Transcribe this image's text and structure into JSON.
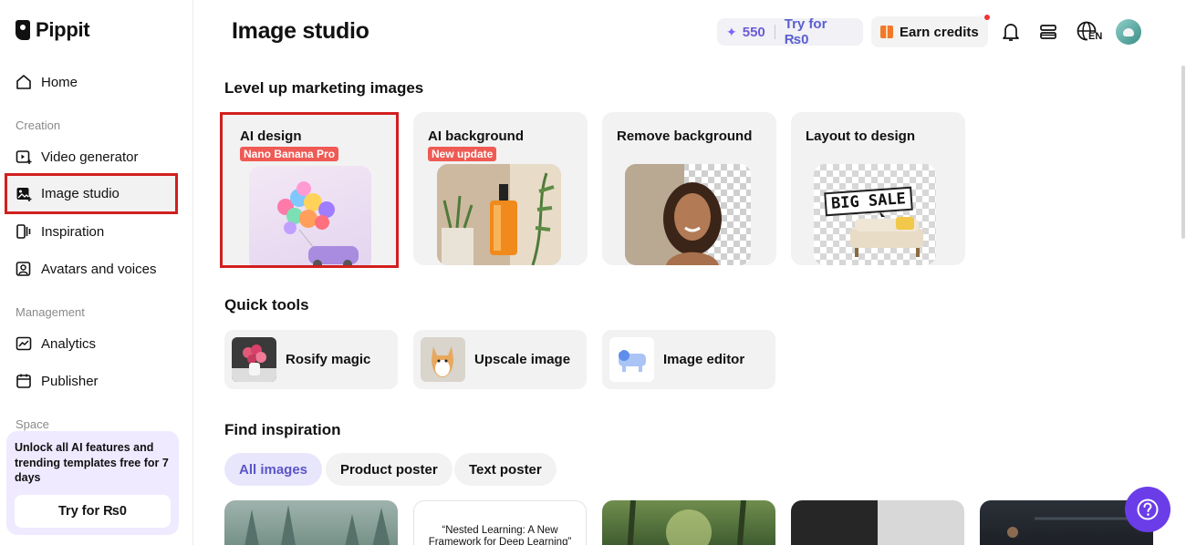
{
  "app": {
    "name": "Pippit"
  },
  "sidebar": {
    "items": [
      {
        "label": "Home",
        "icon": "home-icon"
      },
      {
        "label": "Video generator",
        "icon": "video-plus-icon"
      },
      {
        "label": "Image studio",
        "icon": "image-plus-icon",
        "active": true
      },
      {
        "label": "Inspiration",
        "icon": "inspiration-icon"
      },
      {
        "label": "Avatars and voices",
        "icon": "avatar-icon"
      },
      {
        "label": "Analytics",
        "icon": "analytics-icon"
      },
      {
        "label": "Publisher",
        "icon": "calendar-icon"
      }
    ],
    "sections": {
      "creation": "Creation",
      "management": "Management",
      "space": "Space"
    },
    "promo": {
      "text": "Unlock all AI features and trending templates free for 7 days",
      "button": "Try for ₨0"
    }
  },
  "header": {
    "title": "Image studio",
    "credits": {
      "count": "550",
      "try_label": "Try for ₨0"
    },
    "earn_label": "Earn credits",
    "language": "EN"
  },
  "marketing": {
    "title": "Level up marketing images",
    "cards": [
      {
        "label": "AI design",
        "tag": "Nano Banana Pro"
      },
      {
        "label": "AI background",
        "tag": "New update"
      },
      {
        "label": "Remove background"
      },
      {
        "label": "Layout to design",
        "art_text": "BIG SALE"
      }
    ]
  },
  "quick_tools": {
    "title": "Quick tools",
    "items": [
      {
        "label": "Rosify magic"
      },
      {
        "label": "Upscale image"
      },
      {
        "label": "Image editor"
      }
    ]
  },
  "inspiration": {
    "title": "Find inspiration",
    "filters": [
      "All images",
      "Product poster",
      "Text poster"
    ],
    "thumb_text": "“Nested Learning: A New Framework for Deep Learning”"
  },
  "colors": {
    "accent": "#6a3de8",
    "highlight": "#d21f1f",
    "tag": "#ef5a54"
  }
}
